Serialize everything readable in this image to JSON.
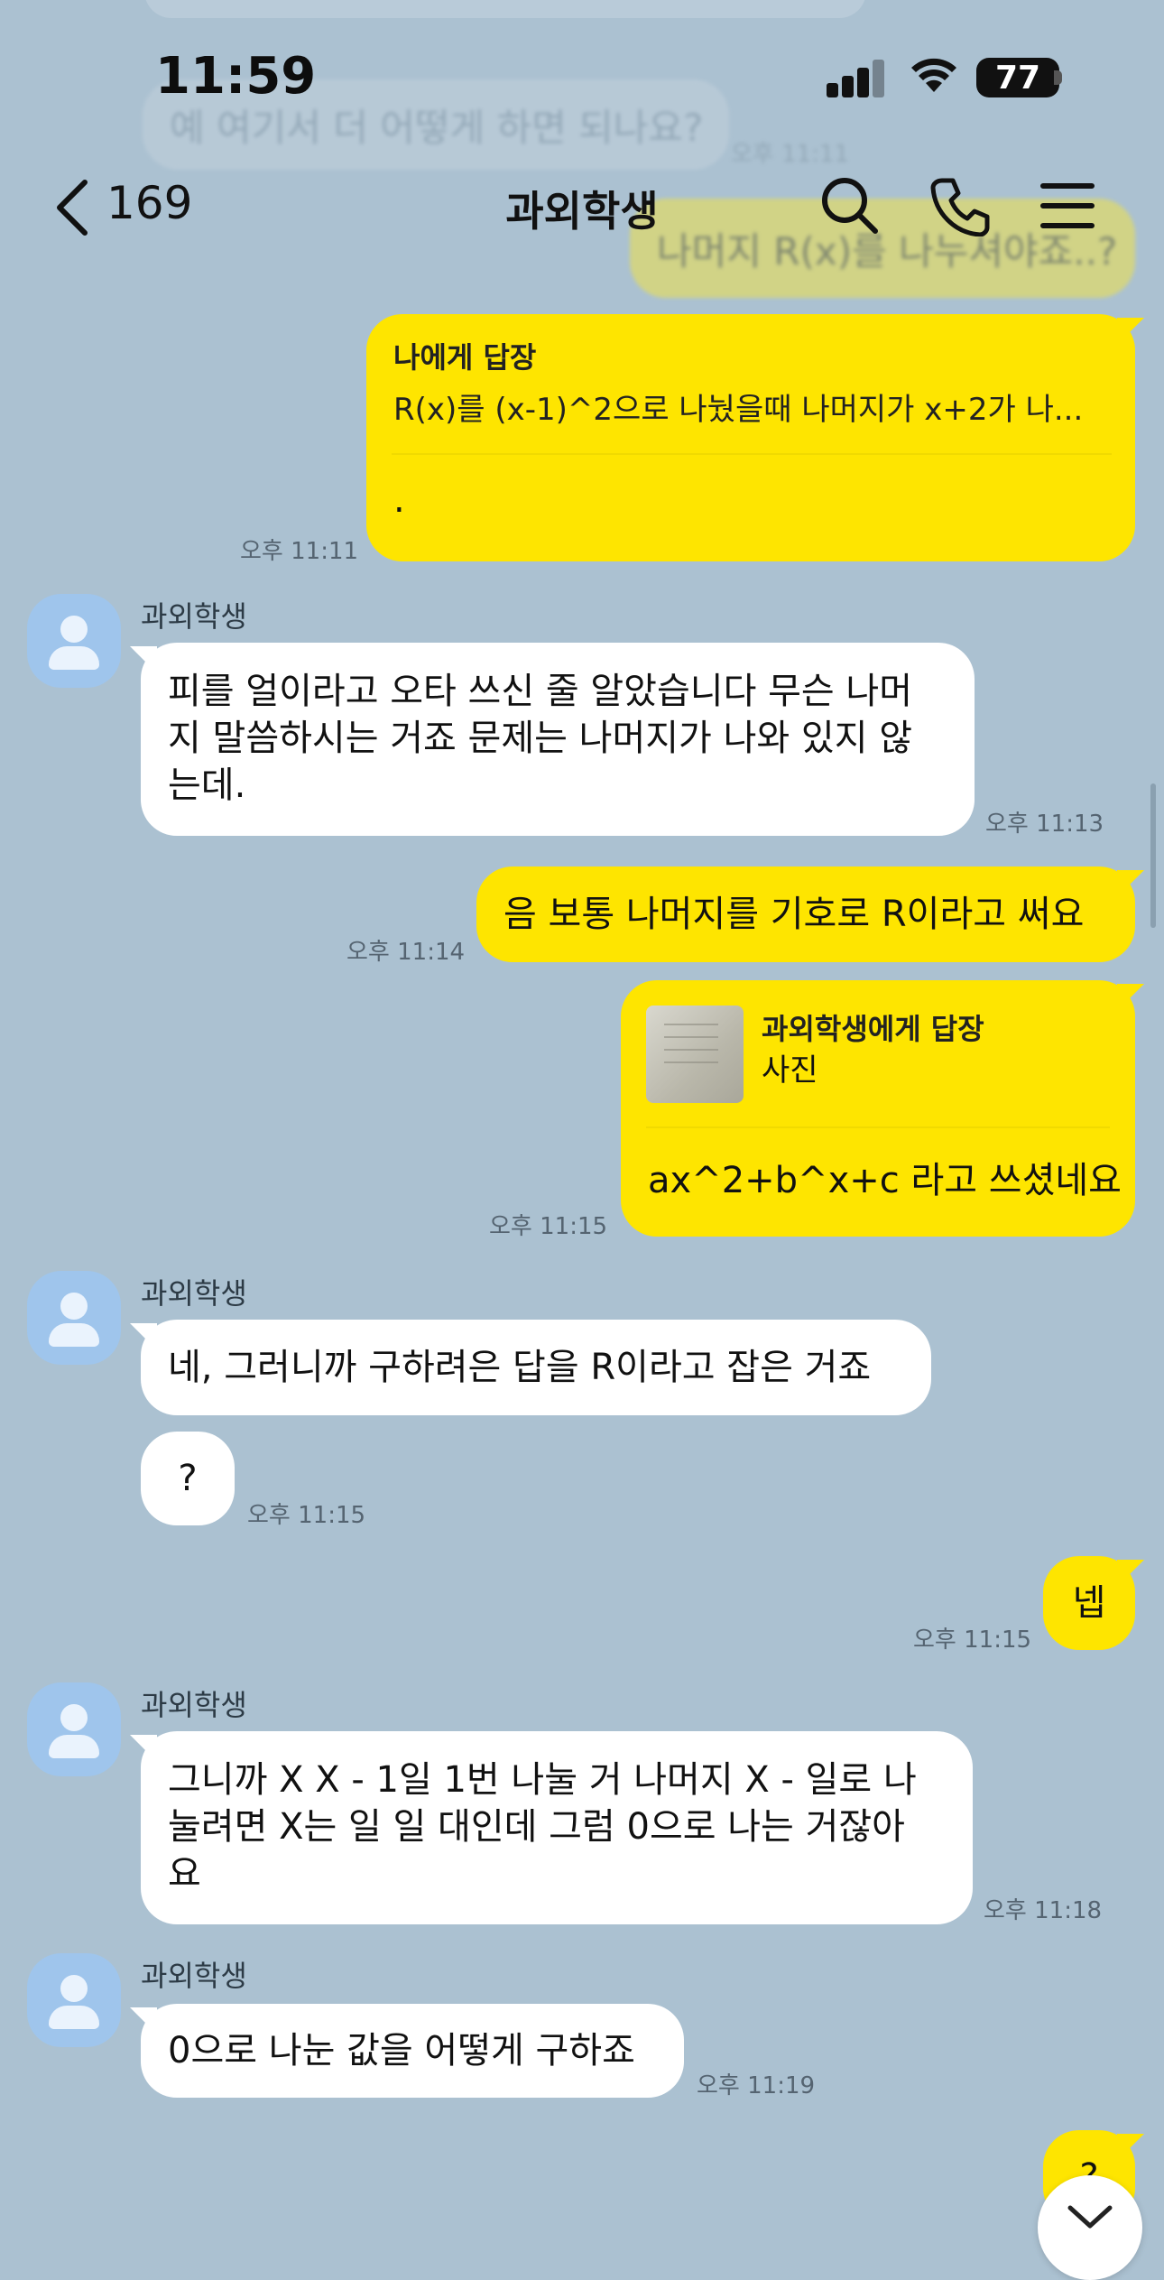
{
  "status_bar": {
    "time": "11:59",
    "battery": "77"
  },
  "background_ghost": {
    "question": "예 여기서 더 어떻게 하면 되나요?",
    "partial": "나머지 R(x)를 나누셔야죠..?"
  },
  "nav": {
    "back_count": "169",
    "title": "과외학생"
  },
  "messages": {
    "m1": {
      "reply_label": "나에게 답장",
      "reply_quote": "R(x)를 (x-1)^2으로 나눴을때 나머지가 x+2가 나...",
      "text": ".",
      "time": "오후 11:11"
    },
    "m2": {
      "sender": "과외학생",
      "lines": [
        "피를 얼이라고 오타 쓰신 줄 알았습니다 무슨 나머",
        "지 말씀하시는 거죠 문제는 나머지가 나와 있지 않",
        "는데."
      ],
      "time": "오후 11:13"
    },
    "m3": {
      "text": "음 보통 나머지를 기호로 R이라고 써요",
      "time": "오후 11:14"
    },
    "m4": {
      "reply_label": "과외학생에게 답장",
      "reply_quote": "사진",
      "text": "ax^2+b^x+c 라고 쓰셨네요",
      "time": "오후 11:15"
    },
    "m5": {
      "sender": "과외학생",
      "text": "네, 그러니까 구하려은 답을 R이라고 잡은 거죠",
      "text2": "?",
      "time": "오후 11:15"
    },
    "m6": {
      "text": "넵",
      "time": "오후 11:15"
    },
    "m7": {
      "sender": "과외학생",
      "lines": [
        "그니까 X X - 1일 1번 나눌 거 나머지 X - 일로 나",
        "눌려면 X는 일 일 대인데 그럼 0으로 나는 거잖아",
        "요"
      ],
      "time": "오후 11:18"
    },
    "m8": {
      "sender": "과외학생",
      "text": "0으로 나눈 값을 어떻게 구하죠",
      "time": "오후 11:19"
    },
    "m9": {
      "text": "?"
    }
  }
}
